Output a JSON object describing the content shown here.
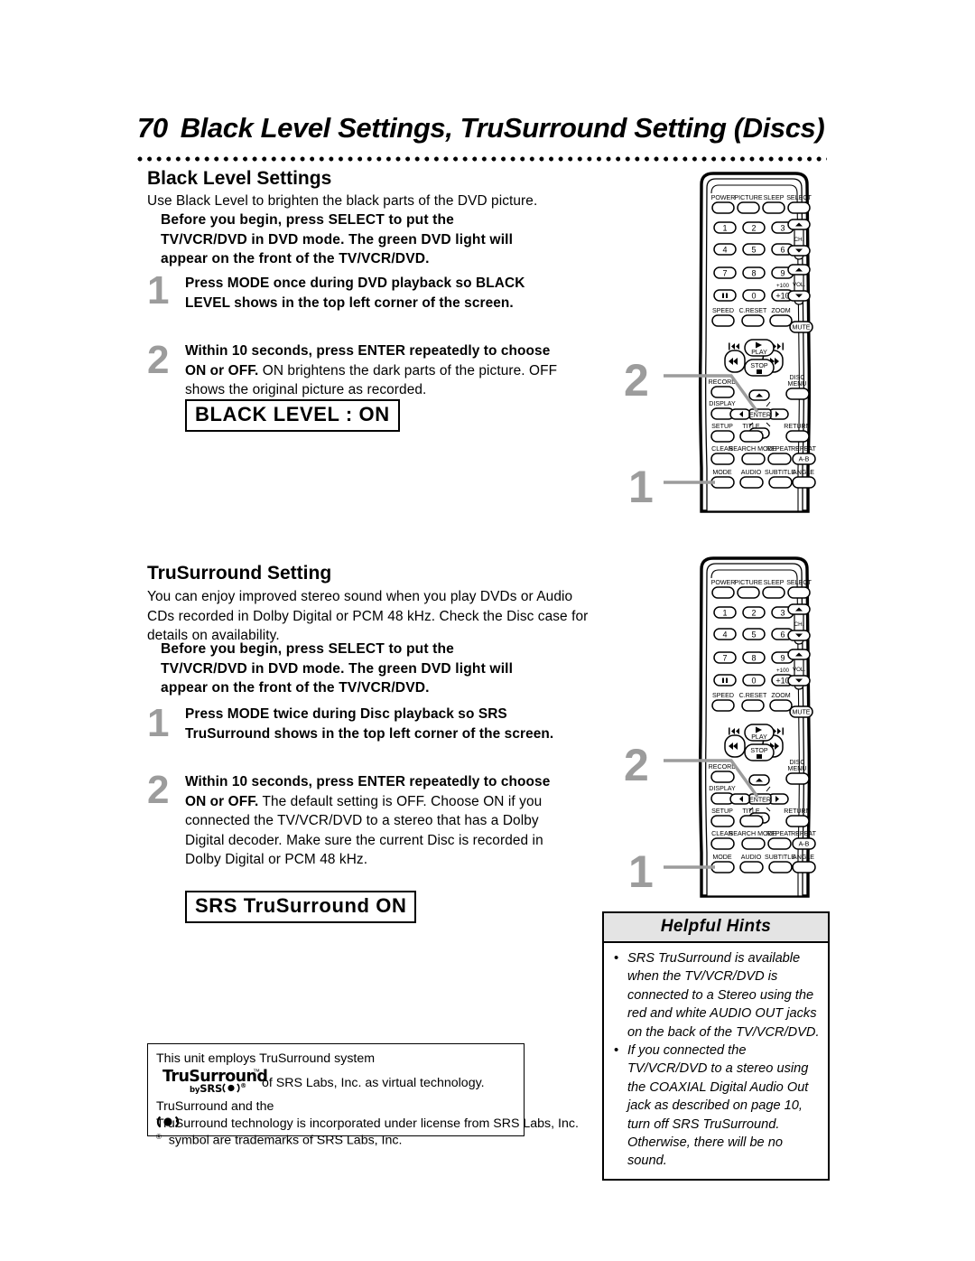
{
  "page": {
    "number": "70",
    "title": "Black Level Settings, TruSurround Setting (Discs)"
  },
  "sections": [
    {
      "heading": "Black Level Settings",
      "intro": "Use Black Level to brighten the black parts of the DVD picture.",
      "before_you_begin": "Before you begin, press SELECT to put the TV/VCR/DVD in DVD mode. The green DVD light will appear on the front of the TV/VCR/DVD.",
      "steps": [
        {
          "number": "1",
          "bold": "Press MODE once during DVD playback so BLACK LEVEL shows in the top left corner of the screen.",
          "rest": ""
        },
        {
          "number": "2",
          "bold": "Within 10 seconds, press ENTER repeatedly to choose ON or OFF.",
          "rest": " ON brightens the dark parts of the picture. OFF shows the original picture as recorded."
        }
      ],
      "osd_label": "BLACK LEVEL : ON"
    },
    {
      "heading": "TruSurround Setting",
      "intro": "You can enjoy improved stereo sound when you play DVDs or Audio CDs recorded in Dolby Digital or PCM 48 kHz. Check the Disc case for details on availability.",
      "before_you_begin": "Before you begin, press SELECT to put the TV/VCR/DVD in DVD mode. The green DVD light will appear on the front of the TV/VCR/DVD.",
      "steps": [
        {
          "number": "1",
          "bold": "Press MODE twice during Disc playback so SRS TruSurround shows in the top left corner of the screen.",
          "rest": ""
        },
        {
          "number": "2",
          "bold": "Within 10 seconds, press ENTER repeatedly to choose ON or OFF.",
          "rest": " The default setting is OFF. Choose ON if you connected the TV/VCR/DVD to a stereo that has a Dolby Digital decoder. Make sure the current Disc is recorded in Dolby Digital or PCM 48 kHz."
        }
      ],
      "osd_label": "SRS TruSurround ON"
    }
  ],
  "helpful_hints": {
    "header": "Helpful Hints",
    "bullet_glyph": "•",
    "items": [
      "SRS TruSurround is available when the TV/VCR/DVD is connected to a Stereo using the red and white AUDIO OUT jacks on the back of the TV/VCR/DVD.",
      "If you connected the TV/VCR/DVD to a stereo using the COAXIAL Digital Audio Out jack as described on page 10, turn off SRS TruSurround. Otherwise, there will be no sound."
    ]
  },
  "trademark_box": {
    "line1": "This unit employs TruSurround system",
    "logo_top": "TruSurround",
    "logo_tm": "™",
    "logo_by": "by",
    "logo_srs": "SRS",
    "line2": "of SRS Labs, Inc. as virtual technology.",
    "line3_pre": "TruSurround and the",
    "line3_post": "symbol are trademarks of SRS Labs, Inc.",
    "line4": "TruSurround technology is incorporated under license from SRS Labs, Inc."
  },
  "remote": {
    "callouts": [
      {
        "number": "2",
        "target": "ENTER"
      },
      {
        "number": "1",
        "target": "MODE"
      }
    ],
    "row_top": [
      "POWER",
      "PICTURE",
      "SLEEP",
      "SELECT"
    ],
    "keypad": [
      [
        "1",
        "2",
        "3"
      ],
      [
        "4",
        "5",
        "6"
      ],
      [
        "7",
        "8",
        "9"
      ],
      [
        "▐▌",
        "0",
        "+10"
      ]
    ],
    "plus100": "+100",
    "ch_label": "CH.",
    "vol_label": "VOL.",
    "mute": "MUTE",
    "row_speed": [
      "SPEED",
      "C.RESET",
      "ZOOM"
    ],
    "transport": {
      "play": "PLAY",
      "stop": "STOP"
    },
    "row_record": [
      "RECORD",
      "DISC MENU"
    ],
    "disc_menu_l1": "DISC",
    "disc_menu_l2": "MENU",
    "display": "DISPLAY",
    "enter": "ENTER",
    "row_setup": [
      "SETUP",
      "TITLE",
      "RETURN"
    ],
    "row_clear": [
      "CLEAR",
      "SEARCH MODE",
      "REPEAT",
      "REPEAT"
    ],
    "repeat_ab": "A-B",
    "row_mode": [
      "MODE",
      "AUDIO",
      "SUBTITLE",
      "ANGLE"
    ]
  }
}
